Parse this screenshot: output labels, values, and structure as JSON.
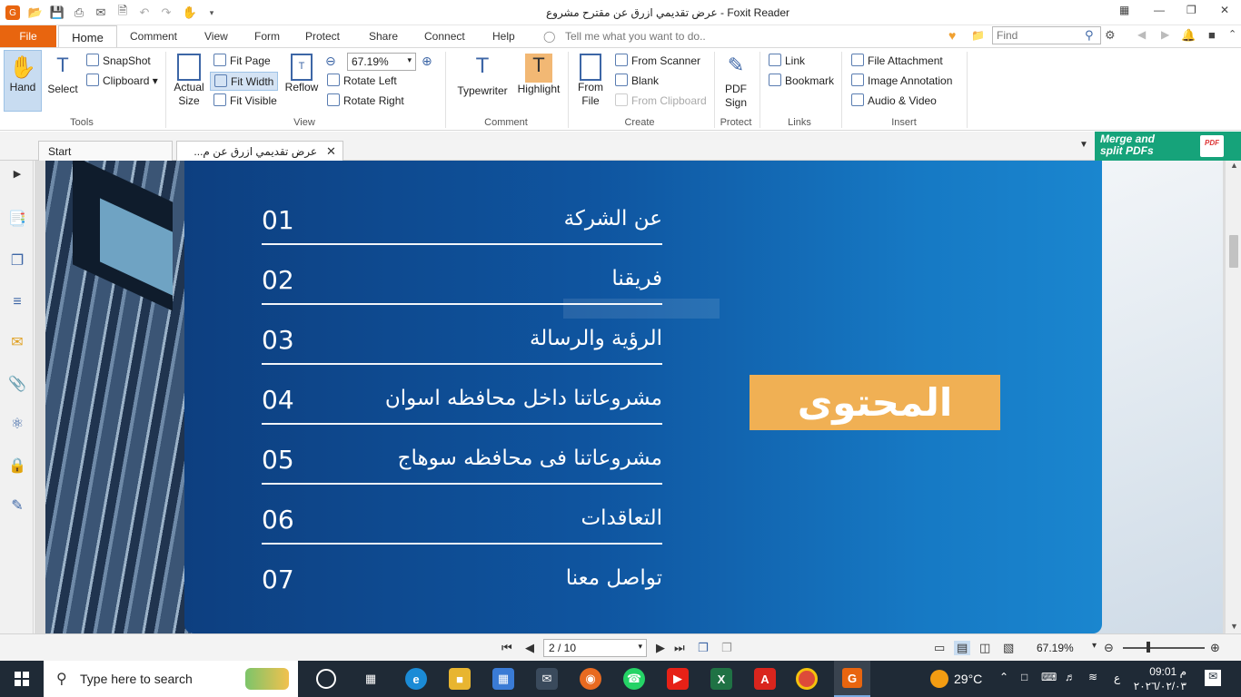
{
  "window": {
    "title": "عرض تقديمي ازرق عن مقترح مشروع - Foxit Reader"
  },
  "menu": {
    "file": "File",
    "tabs": [
      "Home",
      "Comment",
      "View",
      "Form",
      "Protect",
      "Share",
      "Connect",
      "Help"
    ],
    "tell_me": "Tell me what you want to do..",
    "find_placeholder": "Find"
  },
  "ribbon": {
    "tools": {
      "label": "Tools",
      "hand": "Hand",
      "select": "Select",
      "snapshot": "SnapShot",
      "clipboard": "Clipboard"
    },
    "view": {
      "label": "View",
      "actual": "Actual",
      "size": "Size",
      "fit_page": "Fit Page",
      "fit_width": "Fit Width",
      "fit_visible": "Fit Visible",
      "reflow": "Reflow",
      "zoom": "67.19%",
      "rotate_left": "Rotate Left",
      "rotate_right": "Rotate Right"
    },
    "comment": {
      "label": "Comment",
      "typewriter": "Typewriter",
      "highlight": "Highlight"
    },
    "create": {
      "label": "Create",
      "from": "From",
      "file": "File",
      "from_scanner": "From Scanner",
      "blank": "Blank",
      "from_clipboard": "From Clipboard"
    },
    "protect": {
      "label": "Protect",
      "pdf": "PDF",
      "sign": "Sign"
    },
    "links": {
      "label": "Links",
      "link": "Link",
      "bookmark": "Bookmark"
    },
    "insert": {
      "label": "Insert",
      "file_attachment": "File Attachment",
      "image_annotation": "Image Annotation",
      "audio_video": "Audio & Video"
    }
  },
  "doc_tabs": {
    "start": "Start",
    "current": "عرض تقديمي ازرق عن م..."
  },
  "banner": {
    "line1": "Merge and",
    "line2": "split PDFs"
  },
  "slide": {
    "heading": "المحتوى",
    "items": [
      {
        "num": "01",
        "title": "عن الشركة"
      },
      {
        "num": "02",
        "title": "فريقنا"
      },
      {
        "num": "03",
        "title": "الرؤية والرسالة"
      },
      {
        "num": "04",
        "title": "مشروعاتنا داخل محافظه اسوان"
      },
      {
        "num": "05",
        "title": "مشروعاتنا فى محافظه سوهاج"
      },
      {
        "num": "06",
        "title": "التعاقدات"
      },
      {
        "num": "07",
        "title": "تواصل معنا"
      }
    ]
  },
  "status": {
    "page": "2 / 10",
    "zoom": "67.19%"
  },
  "taskbar": {
    "search": "Type here to search",
    "temperature": "29°C",
    "time": "09:01 م",
    "date": "٢٠٢٦/٠٢/٠٣",
    "lang": "ع"
  },
  "colors": {
    "file_tab": "#e8650f",
    "panel_blue": "#0f55a0",
    "heading_box": "#f0b054",
    "banner": "#16a37a"
  }
}
